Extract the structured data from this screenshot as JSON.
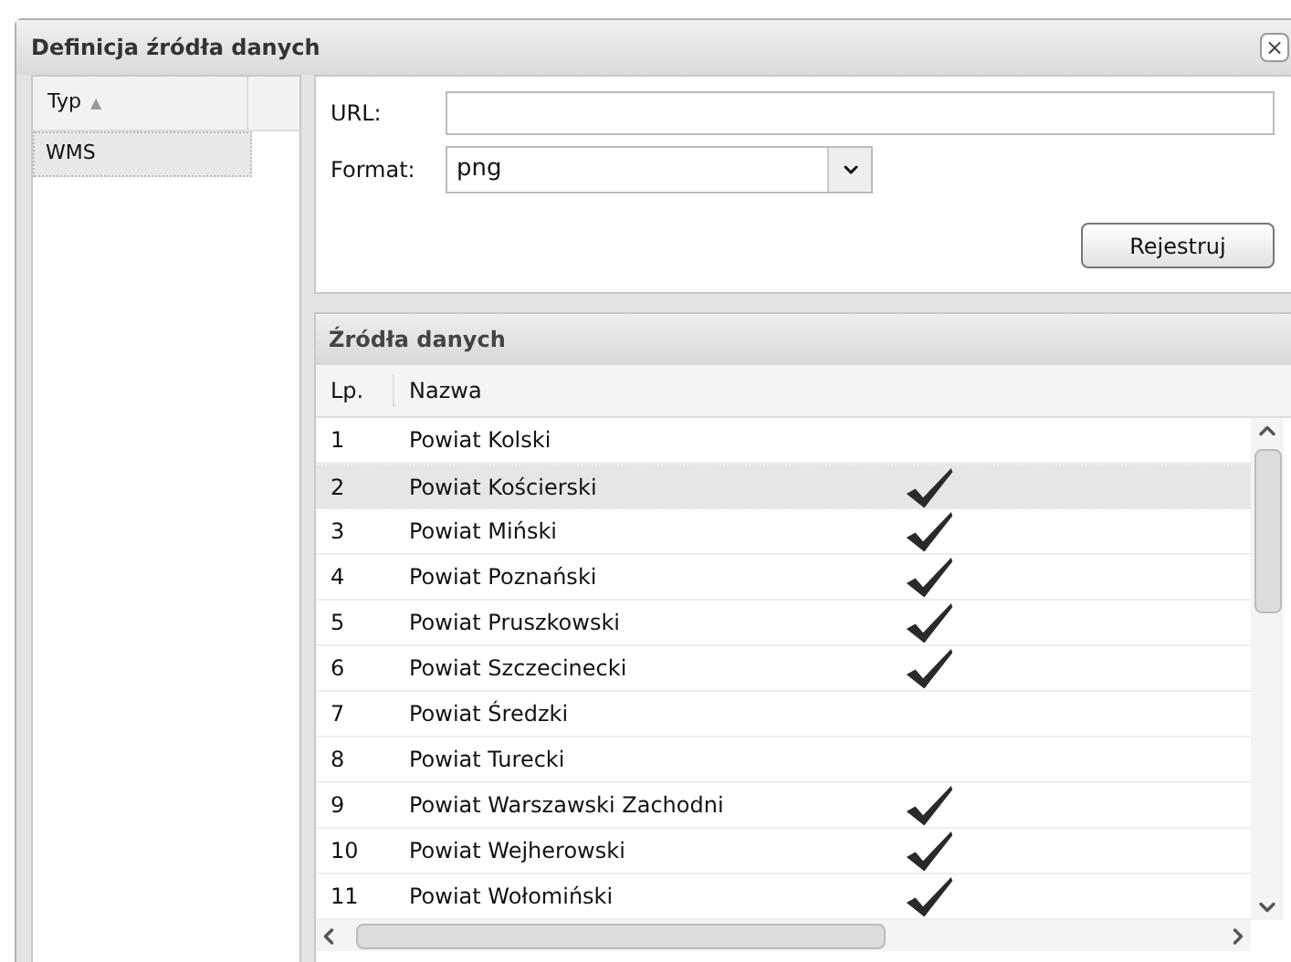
{
  "window": {
    "title": "Definicja źródła danych",
    "close": "×"
  },
  "type_list": {
    "column": "Typ",
    "sort_arrow": "▲",
    "items": [
      {
        "label": "WMS",
        "selected": true
      }
    ]
  },
  "form": {
    "url_label": "URL:",
    "format_label": "Format:",
    "format_value": "png",
    "register_button": "Rejestruj"
  },
  "sources": {
    "title": "Źródła danych",
    "columns": [
      "Lp.",
      "Nazwa"
    ],
    "rows": [
      {
        "lp": "1",
        "name": "Powiat Kolski",
        "checked": false,
        "selected": false
      },
      {
        "lp": "2",
        "name": "Powiat Kościerski",
        "checked": true,
        "selected": true
      },
      {
        "lp": "3",
        "name": "Powiat Miński",
        "checked": true,
        "selected": false
      },
      {
        "lp": "4",
        "name": "Powiat Poznański",
        "checked": true,
        "selected": false
      },
      {
        "lp": "5",
        "name": "Powiat Pruszkowski",
        "checked": true,
        "selected": false
      },
      {
        "lp": "6",
        "name": "Powiat Szczecinecki",
        "checked": true,
        "selected": false
      },
      {
        "lp": "7",
        "name": "Powiat Średzki",
        "checked": false,
        "selected": false
      },
      {
        "lp": "8",
        "name": "Powiat Turecki",
        "checked": false,
        "selected": false
      },
      {
        "lp": "9",
        "name": "Powiat Warszawski Zachodni",
        "checked": true,
        "selected": false
      },
      {
        "lp": "10",
        "name": "Powiat Wejherowski",
        "checked": true,
        "selected": false
      },
      {
        "lp": "11",
        "name": "Powiat Wołomiński",
        "checked": true,
        "selected": false
      }
    ]
  }
}
